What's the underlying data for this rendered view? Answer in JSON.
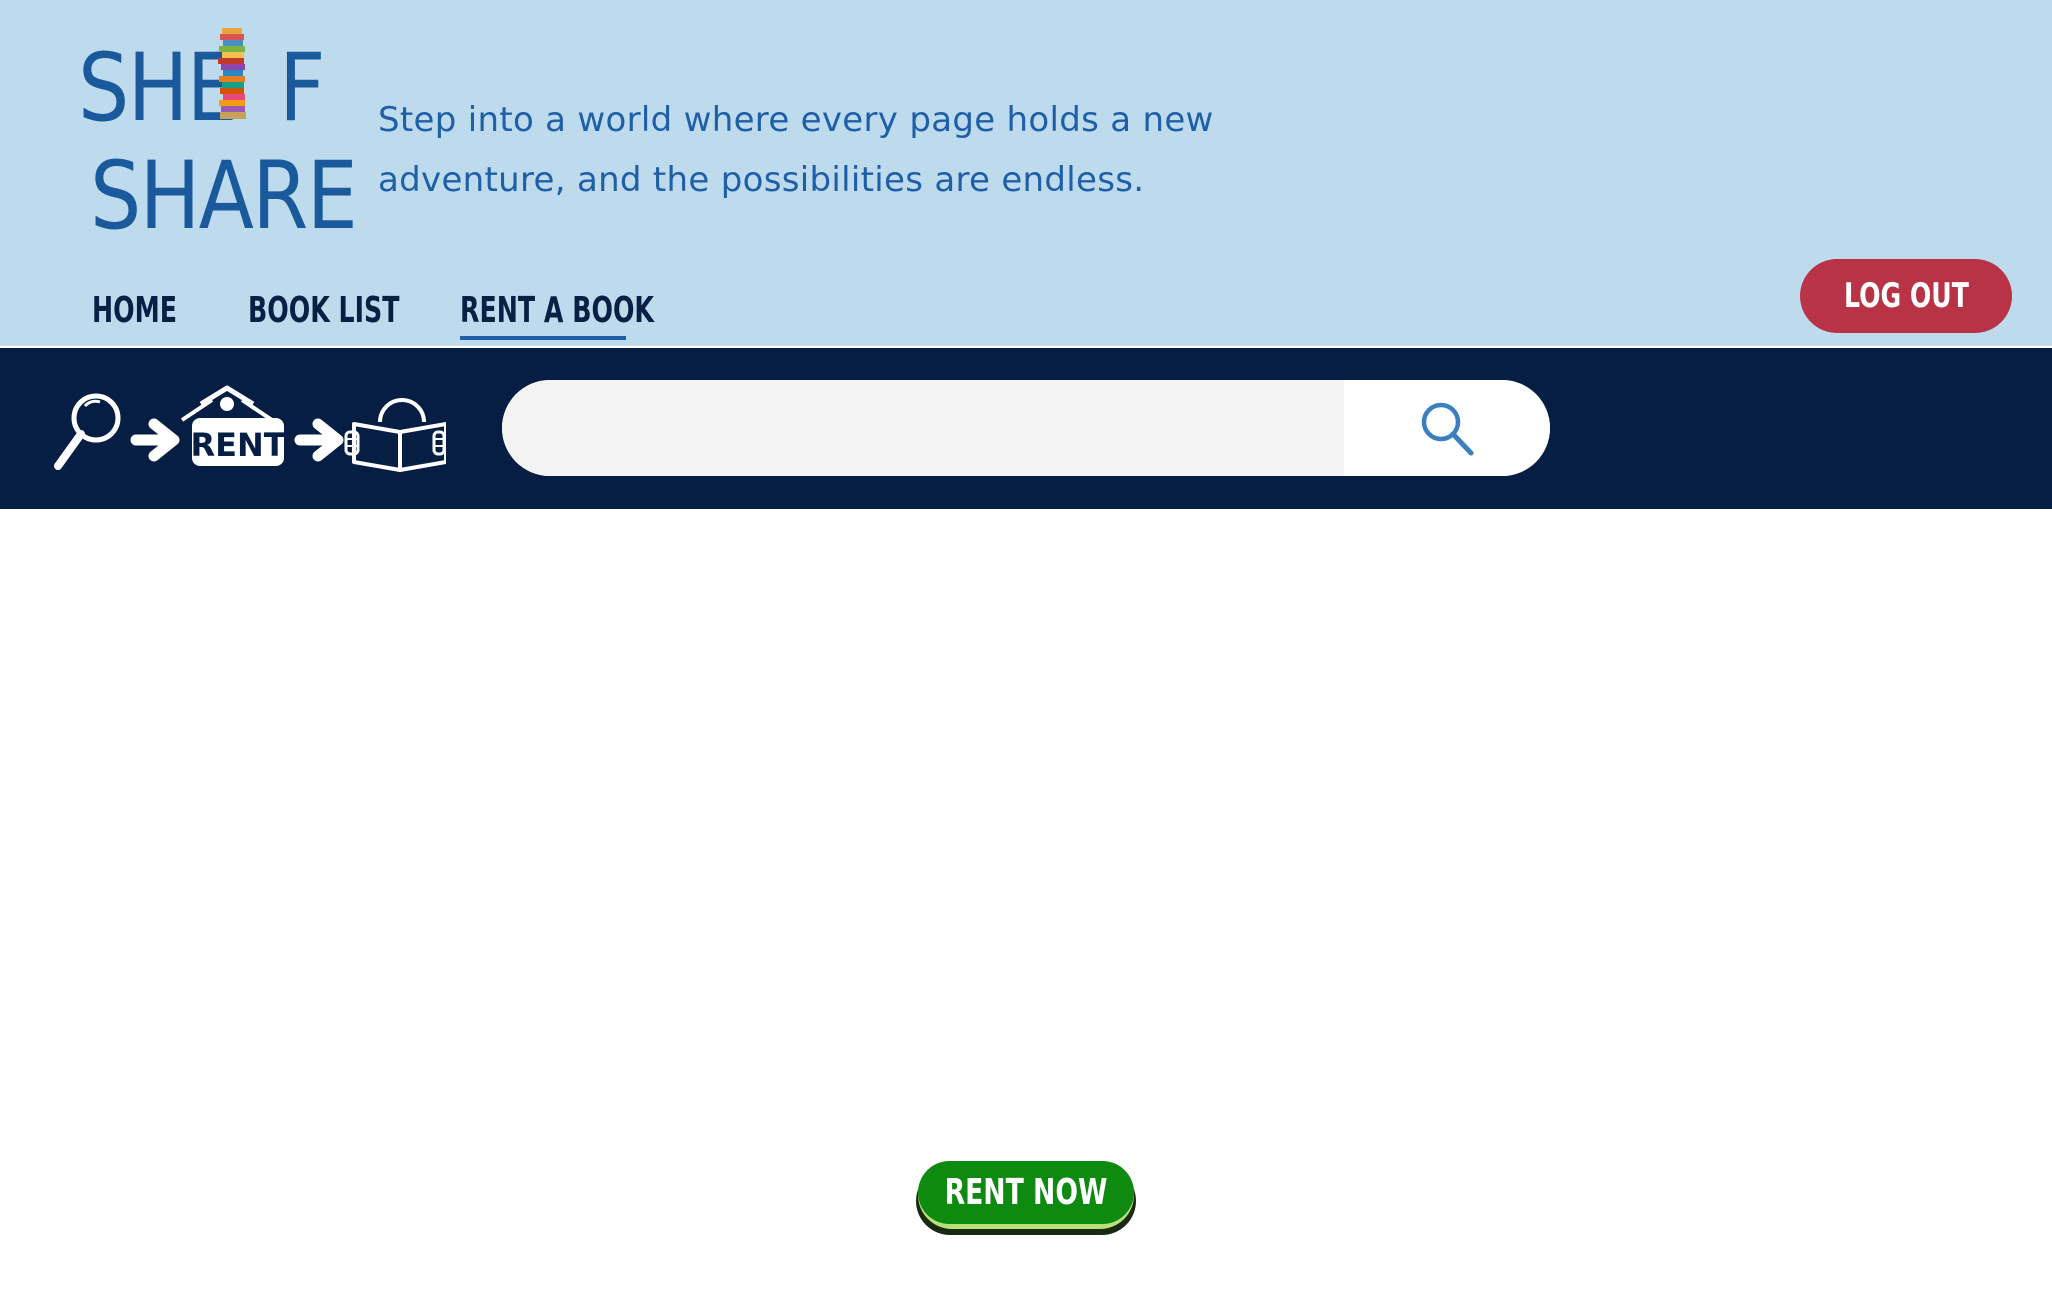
{
  "brand": {
    "logo_line_1": "SHE",
    "logo_line_1_end": "F",
    "logo_line_2": "SHARE",
    "tagline": "Step into a world where every page holds a new adventure, and the possibilities are endless.",
    "text_color": "#1f5fa8"
  },
  "nav": {
    "items": [
      {
        "label": "HOME"
      },
      {
        "label": "BOOK LIST"
      },
      {
        "label": "RENT A BOOK",
        "active": true
      }
    ],
    "logout_label": "LOG OUT"
  },
  "search": {
    "value": "",
    "placeholder": "",
    "flow_sign_text": "RENT",
    "flow_icons": [
      "magnifier-icon",
      "arrow-right-icon",
      "rent-sign-icon",
      "arrow-right-icon",
      "person-reading-icon"
    ]
  },
  "cta": {
    "label": "RENT NOW"
  },
  "colors": {
    "header_bg": "#bddbec",
    "band_bg": "#061e44",
    "nav_text": "#0a1f44",
    "logout_bg": "#b83346",
    "cta_bg": "#0f8a10",
    "search_icon": "#3a7fc0"
  }
}
